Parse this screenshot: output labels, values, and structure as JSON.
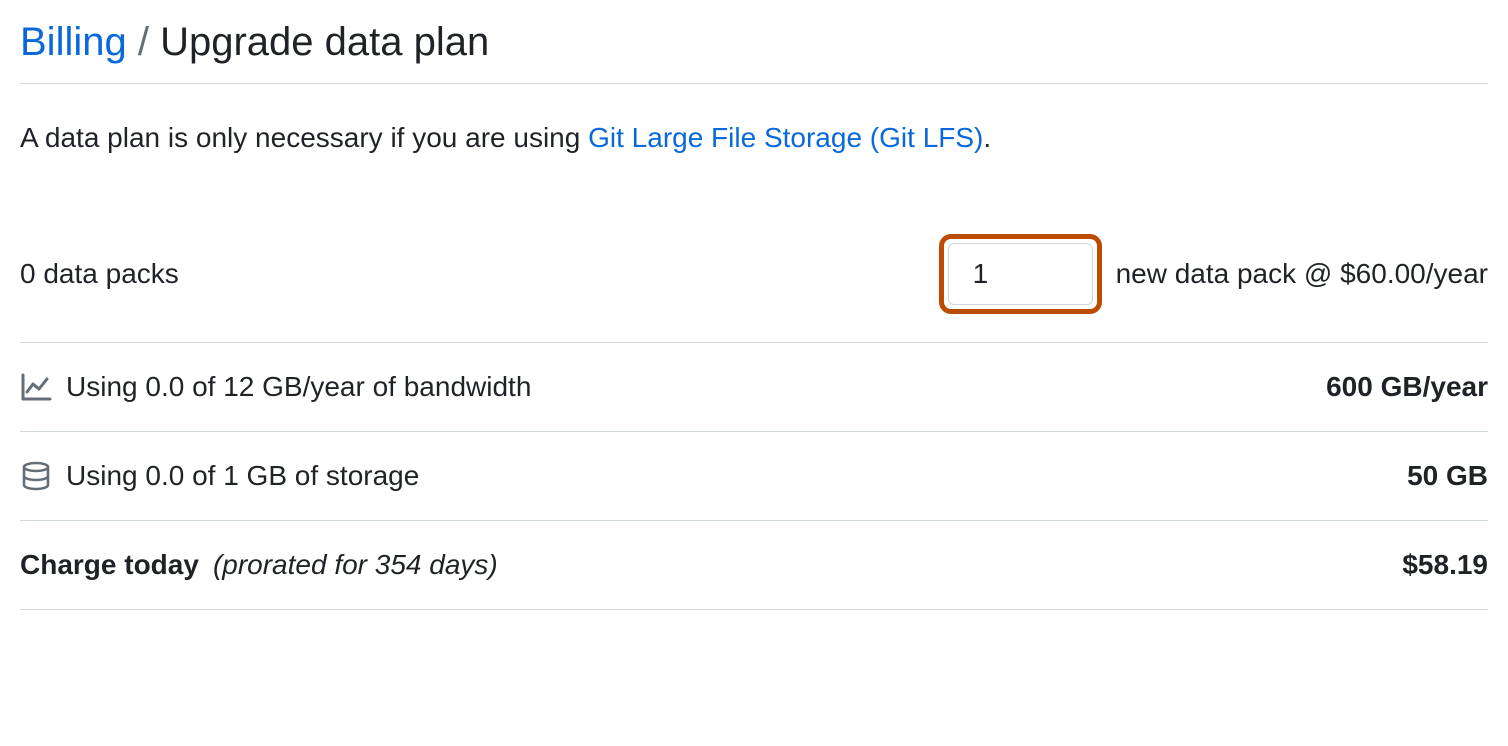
{
  "header": {
    "billing_link": "Billing",
    "separator": " / ",
    "title": "Upgrade data plan"
  },
  "description": {
    "prefix": "A data plan is only necessary if you are using ",
    "link_text": "Git Large File Storage (Git LFS)",
    "suffix": "."
  },
  "data_packs_row": {
    "current": "0 data packs",
    "input_value": "1",
    "suffix": "new data pack @ $60.00/year"
  },
  "bandwidth_row": {
    "usage": "Using 0.0 of 12 GB/year of bandwidth",
    "quota": "600 GB/year"
  },
  "storage_row": {
    "usage": "Using 0.0 of 1 GB of storage",
    "quota": "50 GB"
  },
  "charge_row": {
    "label": "Charge today",
    "prorated": "(prorated for 354 days)",
    "amount": "$58.19"
  }
}
